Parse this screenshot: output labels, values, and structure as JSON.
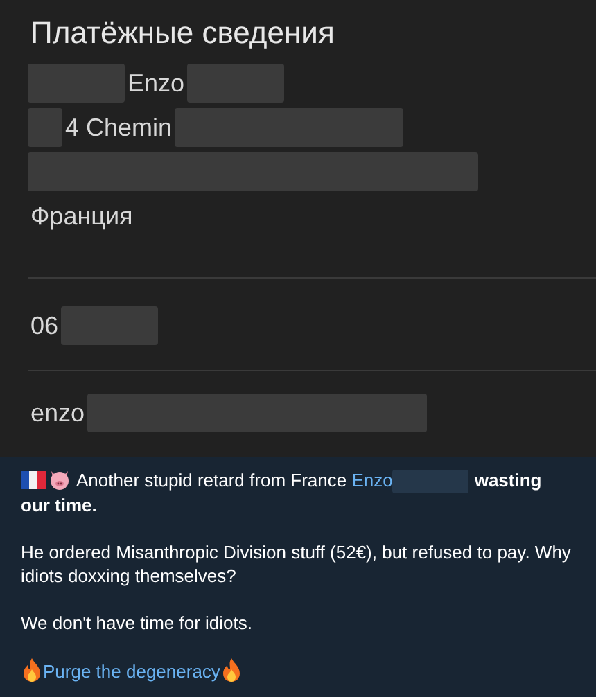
{
  "title": "Платёжные сведения",
  "address_lines": [
    {
      "parts": [
        {
          "kind": "redacted"
        },
        {
          "kind": "text",
          "text": "Enzo"
        },
        {
          "kind": "redacted"
        }
      ]
    },
    {
      "parts": [
        {
          "kind": "redacted"
        },
        {
          "kind": "text",
          "text": "4 Chemin"
        },
        {
          "kind": "redacted"
        }
      ]
    },
    {
      "parts": [
        {
          "kind": "redacted"
        }
      ]
    },
    {
      "parts": [
        {
          "kind": "text",
          "text": "Франция"
        }
      ]
    }
  ],
  "phone": {
    "parts": [
      {
        "kind": "text",
        "text": "06"
      },
      {
        "kind": "redacted"
      }
    ]
  },
  "email": {
    "parts": [
      {
        "kind": "text",
        "text": "enzo"
      },
      {
        "kind": "redacted"
      }
    ]
  },
  "message": [
    {
      "parts": [
        {
          "kind": "flag"
        },
        {
          "kind": "pig"
        },
        {
          "kind": "text",
          "text": "Another stupid retard from France "
        },
        {
          "kind": "link",
          "text": "Enzo"
        },
        {
          "kind": "redacted"
        },
        {
          "kind": "bold",
          "text": "wasting our time."
        }
      ]
    },
    {
      "parts": [
        {
          "kind": "text",
          "text": "He ordered Misanthropic Division stuff (52€), but refused to pay. Why idiots doxxing themselves?"
        }
      ]
    },
    {
      "parts": [
        {
          "kind": "text",
          "text": "We don't have time for idiots."
        }
      ]
    },
    {
      "parts": [
        {
          "kind": "fire"
        },
        {
          "kind": "link",
          "text": "Purge the degeneracy"
        },
        {
          "kind": "fire"
        }
      ]
    }
  ]
}
